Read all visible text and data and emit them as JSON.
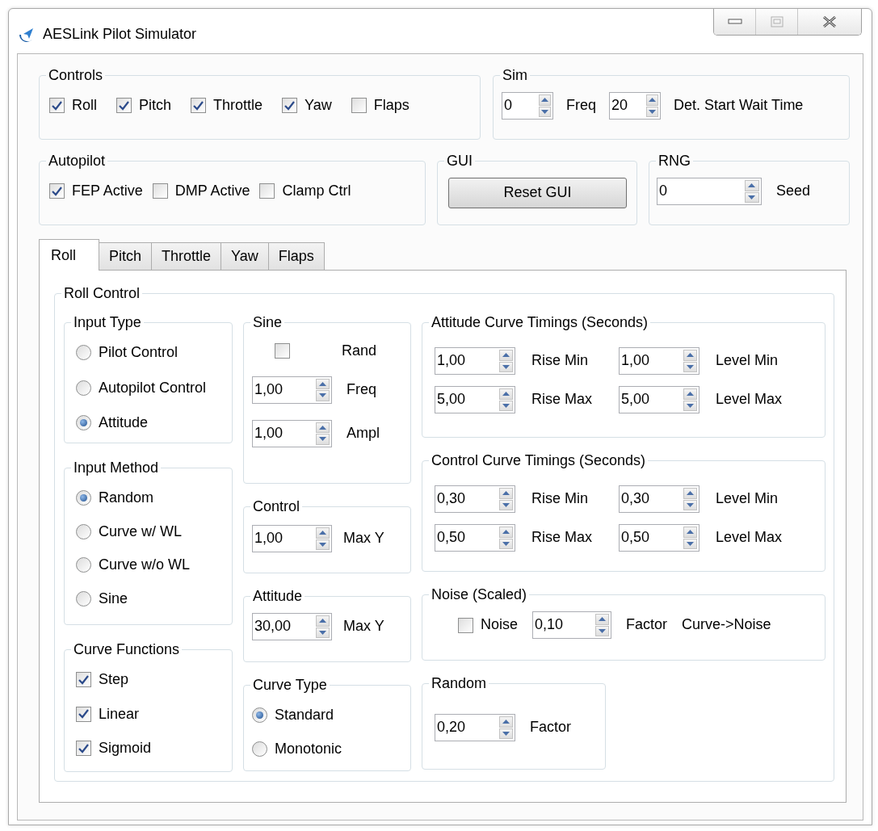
{
  "window": {
    "title": "AESLink Pilot Simulator"
  },
  "top_groups": [
    {
      "title": "Controls",
      "rows": [
        [
          {
            "kind": "check",
            "label": "Roll",
            "checked": true
          },
          {
            "kind": "check",
            "label": "Pitch",
            "checked": true
          },
          {
            "kind": "check",
            "label": "Throttle",
            "checked": true
          },
          {
            "kind": "check",
            "label": "Yaw",
            "checked": true
          },
          {
            "kind": "check",
            "label": "Flaps",
            "checked": false
          }
        ]
      ]
    },
    {
      "title": "Sim",
      "rows": [
        [
          {
            "kind": "spin",
            "value": "0"
          },
          {
            "kind": "text",
            "text": "Freq"
          },
          {
            "kind": "spin",
            "value": "20"
          },
          {
            "kind": "text",
            "text": "Det. Start Wait Time"
          }
        ]
      ]
    },
    {
      "title": "Autopilot",
      "rows": [
        [
          {
            "kind": "check",
            "label": "FEP Active",
            "checked": true
          },
          {
            "kind": "check",
            "label": "DMP Active",
            "checked": false
          },
          {
            "kind": "check",
            "label": "Clamp Ctrl",
            "checked": false
          }
        ]
      ]
    },
    {
      "title": "GUI",
      "rows": [
        [
          {
            "kind": "button",
            "label": "Reset GUI"
          }
        ]
      ]
    },
    {
      "title": "RNG",
      "rows": [
        [
          {
            "kind": "spin",
            "value": "0"
          },
          {
            "kind": "text",
            "text": "Seed"
          }
        ]
      ]
    }
  ],
  "tabs": [
    {
      "label": "Roll",
      "selected": true
    },
    {
      "label": "Pitch",
      "selected": false
    },
    {
      "label": "Throttle",
      "selected": false
    },
    {
      "label": "Yaw",
      "selected": false
    },
    {
      "label": "Flaps",
      "selected": false
    }
  ],
  "tab_page": {
    "title": "Roll Control",
    "columns": [
      [
        {
          "title": "Input Type",
          "rows": [
            [
              {
                "kind": "radio",
                "label": "Pilot Control",
                "selected": false
              }
            ],
            [
              {
                "kind": "radio",
                "label": "Autopilot Control",
                "selected": false
              }
            ],
            [
              {
                "kind": "radio",
                "label": "Attitude",
                "selected": true
              }
            ]
          ]
        },
        {
          "title": "Input Method",
          "rows": [
            [
              {
                "kind": "radio",
                "label": "Random",
                "selected": true
              }
            ],
            [
              {
                "kind": "radio",
                "label": "Curve w/ WL",
                "selected": false
              }
            ],
            [
              {
                "kind": "radio",
                "label": "Curve w/o WL",
                "selected": false
              }
            ],
            [
              {
                "kind": "radio",
                "label": "Sine",
                "selected": false
              }
            ]
          ]
        },
        {
          "title": "Curve Functions",
          "rows": [
            [
              {
                "kind": "check",
                "label": "Step",
                "checked": true
              }
            ],
            [
              {
                "kind": "check",
                "label": "Linear",
                "checked": true
              }
            ],
            [
              {
                "kind": "check",
                "label": "Sigmoid",
                "checked": true
              }
            ]
          ]
        }
      ],
      [
        {
          "title": "Sine",
          "rows": [
            [
              {
                "kind": "check",
                "checked": false
              },
              {
                "kind": "text",
                "text": "Rand"
              }
            ],
            [
              {
                "kind": "spin",
                "value": "1,00"
              },
              {
                "kind": "text",
                "text": "Freq"
              }
            ],
            [
              {
                "kind": "spin",
                "value": "1,00"
              },
              {
                "kind": "text",
                "text": "Ampl"
              }
            ]
          ]
        },
        {
          "title": "Control",
          "rows": [
            [
              {
                "kind": "spin",
                "value": "1,00"
              },
              {
                "kind": "text",
                "text": "Max Y"
              }
            ]
          ]
        },
        {
          "title": "Attitude",
          "rows": [
            [
              {
                "kind": "spin",
                "value": "30,00"
              },
              {
                "kind": "text",
                "text": "Max Y"
              }
            ]
          ]
        },
        {
          "title": "Curve Type",
          "rows": [
            [
              {
                "kind": "radio",
                "label": "Standard",
                "selected": true
              }
            ],
            [
              {
                "kind": "radio",
                "label": "Monotonic",
                "selected": false
              }
            ]
          ]
        }
      ],
      [
        {
          "title": "Attitude Curve Timings (Seconds)",
          "rows": [
            [
              {
                "kind": "spin",
                "value": "1,00"
              },
              {
                "kind": "text",
                "text": "Rise Min"
              },
              {
                "kind": "spin",
                "value": "1,00"
              },
              {
                "kind": "text",
                "text": "Level Min"
              }
            ],
            [
              {
                "kind": "spin",
                "value": "5,00"
              },
              {
                "kind": "text",
                "text": "Rise Max"
              },
              {
                "kind": "spin",
                "value": "5,00"
              },
              {
                "kind": "text",
                "text": "Level Max"
              }
            ]
          ]
        },
        {
          "title": "Control Curve Timings (Seconds)",
          "rows": [
            [
              {
                "kind": "spin",
                "value": "0,30"
              },
              {
                "kind": "text",
                "text": "Rise Min"
              },
              {
                "kind": "spin",
                "value": "0,30"
              },
              {
                "kind": "text",
                "text": "Level Min"
              }
            ],
            [
              {
                "kind": "spin",
                "value": "0,50"
              },
              {
                "kind": "text",
                "text": "Rise Max"
              },
              {
                "kind": "spin",
                "value": "0,50"
              },
              {
                "kind": "text",
                "text": "Level Max"
              }
            ]
          ]
        },
        {
          "title": "Noise (Scaled)",
          "rows": [
            [
              {
                "kind": "check",
                "label": "Noise",
                "checked": false
              },
              {
                "kind": "spin",
                "value": "0,10"
              },
              {
                "kind": "text",
                "text": "Factor"
              },
              {
                "kind": "text",
                "text": "Curve->Noise"
              }
            ]
          ]
        },
        {
          "title": "Random",
          "rows": [
            [
              {
                "kind": "spin",
                "value": "0,20"
              },
              {
                "kind": "text",
                "text": "Factor"
              }
            ]
          ]
        }
      ]
    ]
  }
}
